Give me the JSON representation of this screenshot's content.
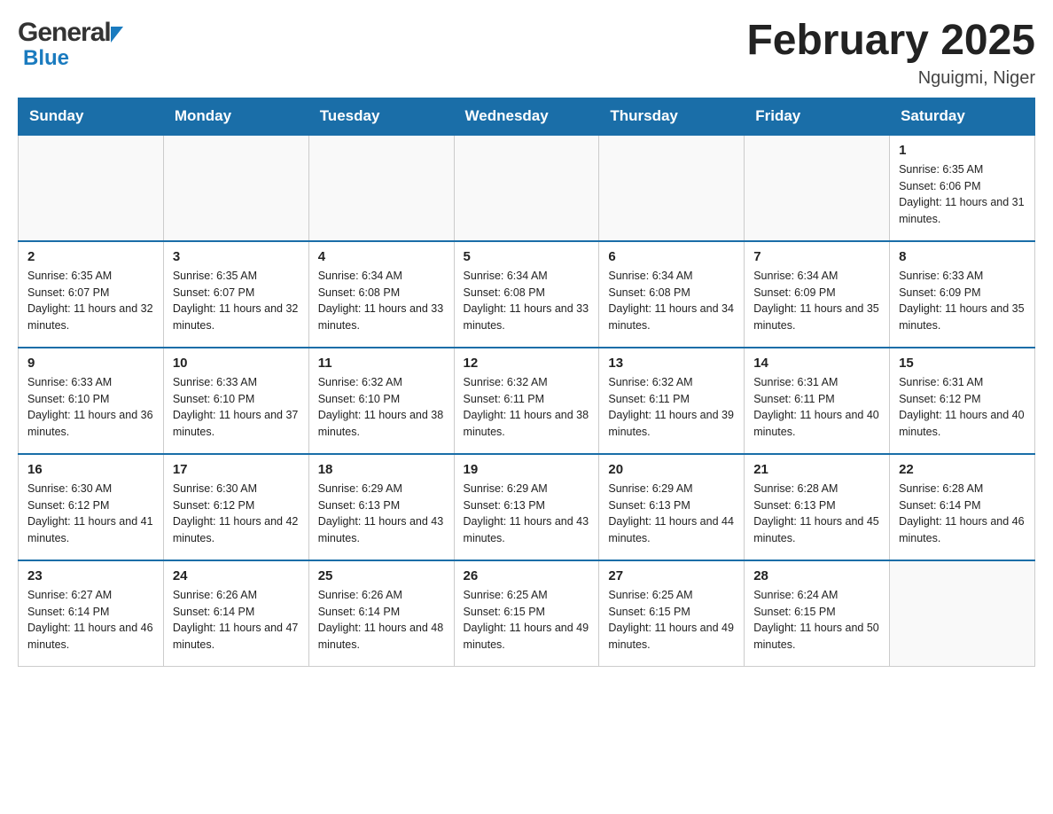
{
  "header": {
    "logo_general": "General",
    "logo_blue": "Blue",
    "month_title": "February 2025",
    "location": "Nguigmi, Niger"
  },
  "days_of_week": [
    "Sunday",
    "Monday",
    "Tuesday",
    "Wednesday",
    "Thursday",
    "Friday",
    "Saturday"
  ],
  "weeks": [
    [
      {
        "day": "",
        "info": ""
      },
      {
        "day": "",
        "info": ""
      },
      {
        "day": "",
        "info": ""
      },
      {
        "day": "",
        "info": ""
      },
      {
        "day": "",
        "info": ""
      },
      {
        "day": "",
        "info": ""
      },
      {
        "day": "1",
        "info": "Sunrise: 6:35 AM\nSunset: 6:06 PM\nDaylight: 11 hours and 31 minutes."
      }
    ],
    [
      {
        "day": "2",
        "info": "Sunrise: 6:35 AM\nSunset: 6:07 PM\nDaylight: 11 hours and 32 minutes."
      },
      {
        "day": "3",
        "info": "Sunrise: 6:35 AM\nSunset: 6:07 PM\nDaylight: 11 hours and 32 minutes."
      },
      {
        "day": "4",
        "info": "Sunrise: 6:34 AM\nSunset: 6:08 PM\nDaylight: 11 hours and 33 minutes."
      },
      {
        "day": "5",
        "info": "Sunrise: 6:34 AM\nSunset: 6:08 PM\nDaylight: 11 hours and 33 minutes."
      },
      {
        "day": "6",
        "info": "Sunrise: 6:34 AM\nSunset: 6:08 PM\nDaylight: 11 hours and 34 minutes."
      },
      {
        "day": "7",
        "info": "Sunrise: 6:34 AM\nSunset: 6:09 PM\nDaylight: 11 hours and 35 minutes."
      },
      {
        "day": "8",
        "info": "Sunrise: 6:33 AM\nSunset: 6:09 PM\nDaylight: 11 hours and 35 minutes."
      }
    ],
    [
      {
        "day": "9",
        "info": "Sunrise: 6:33 AM\nSunset: 6:10 PM\nDaylight: 11 hours and 36 minutes."
      },
      {
        "day": "10",
        "info": "Sunrise: 6:33 AM\nSunset: 6:10 PM\nDaylight: 11 hours and 37 minutes."
      },
      {
        "day": "11",
        "info": "Sunrise: 6:32 AM\nSunset: 6:10 PM\nDaylight: 11 hours and 38 minutes."
      },
      {
        "day": "12",
        "info": "Sunrise: 6:32 AM\nSunset: 6:11 PM\nDaylight: 11 hours and 38 minutes."
      },
      {
        "day": "13",
        "info": "Sunrise: 6:32 AM\nSunset: 6:11 PM\nDaylight: 11 hours and 39 minutes."
      },
      {
        "day": "14",
        "info": "Sunrise: 6:31 AM\nSunset: 6:11 PM\nDaylight: 11 hours and 40 minutes."
      },
      {
        "day": "15",
        "info": "Sunrise: 6:31 AM\nSunset: 6:12 PM\nDaylight: 11 hours and 40 minutes."
      }
    ],
    [
      {
        "day": "16",
        "info": "Sunrise: 6:30 AM\nSunset: 6:12 PM\nDaylight: 11 hours and 41 minutes."
      },
      {
        "day": "17",
        "info": "Sunrise: 6:30 AM\nSunset: 6:12 PM\nDaylight: 11 hours and 42 minutes."
      },
      {
        "day": "18",
        "info": "Sunrise: 6:29 AM\nSunset: 6:13 PM\nDaylight: 11 hours and 43 minutes."
      },
      {
        "day": "19",
        "info": "Sunrise: 6:29 AM\nSunset: 6:13 PM\nDaylight: 11 hours and 43 minutes."
      },
      {
        "day": "20",
        "info": "Sunrise: 6:29 AM\nSunset: 6:13 PM\nDaylight: 11 hours and 44 minutes."
      },
      {
        "day": "21",
        "info": "Sunrise: 6:28 AM\nSunset: 6:13 PM\nDaylight: 11 hours and 45 minutes."
      },
      {
        "day": "22",
        "info": "Sunrise: 6:28 AM\nSunset: 6:14 PM\nDaylight: 11 hours and 46 minutes."
      }
    ],
    [
      {
        "day": "23",
        "info": "Sunrise: 6:27 AM\nSunset: 6:14 PM\nDaylight: 11 hours and 46 minutes."
      },
      {
        "day": "24",
        "info": "Sunrise: 6:26 AM\nSunset: 6:14 PM\nDaylight: 11 hours and 47 minutes."
      },
      {
        "day": "25",
        "info": "Sunrise: 6:26 AM\nSunset: 6:14 PM\nDaylight: 11 hours and 48 minutes."
      },
      {
        "day": "26",
        "info": "Sunrise: 6:25 AM\nSunset: 6:15 PM\nDaylight: 11 hours and 49 minutes."
      },
      {
        "day": "27",
        "info": "Sunrise: 6:25 AM\nSunset: 6:15 PM\nDaylight: 11 hours and 49 minutes."
      },
      {
        "day": "28",
        "info": "Sunrise: 6:24 AM\nSunset: 6:15 PM\nDaylight: 11 hours and 50 minutes."
      },
      {
        "day": "",
        "info": ""
      }
    ]
  ]
}
